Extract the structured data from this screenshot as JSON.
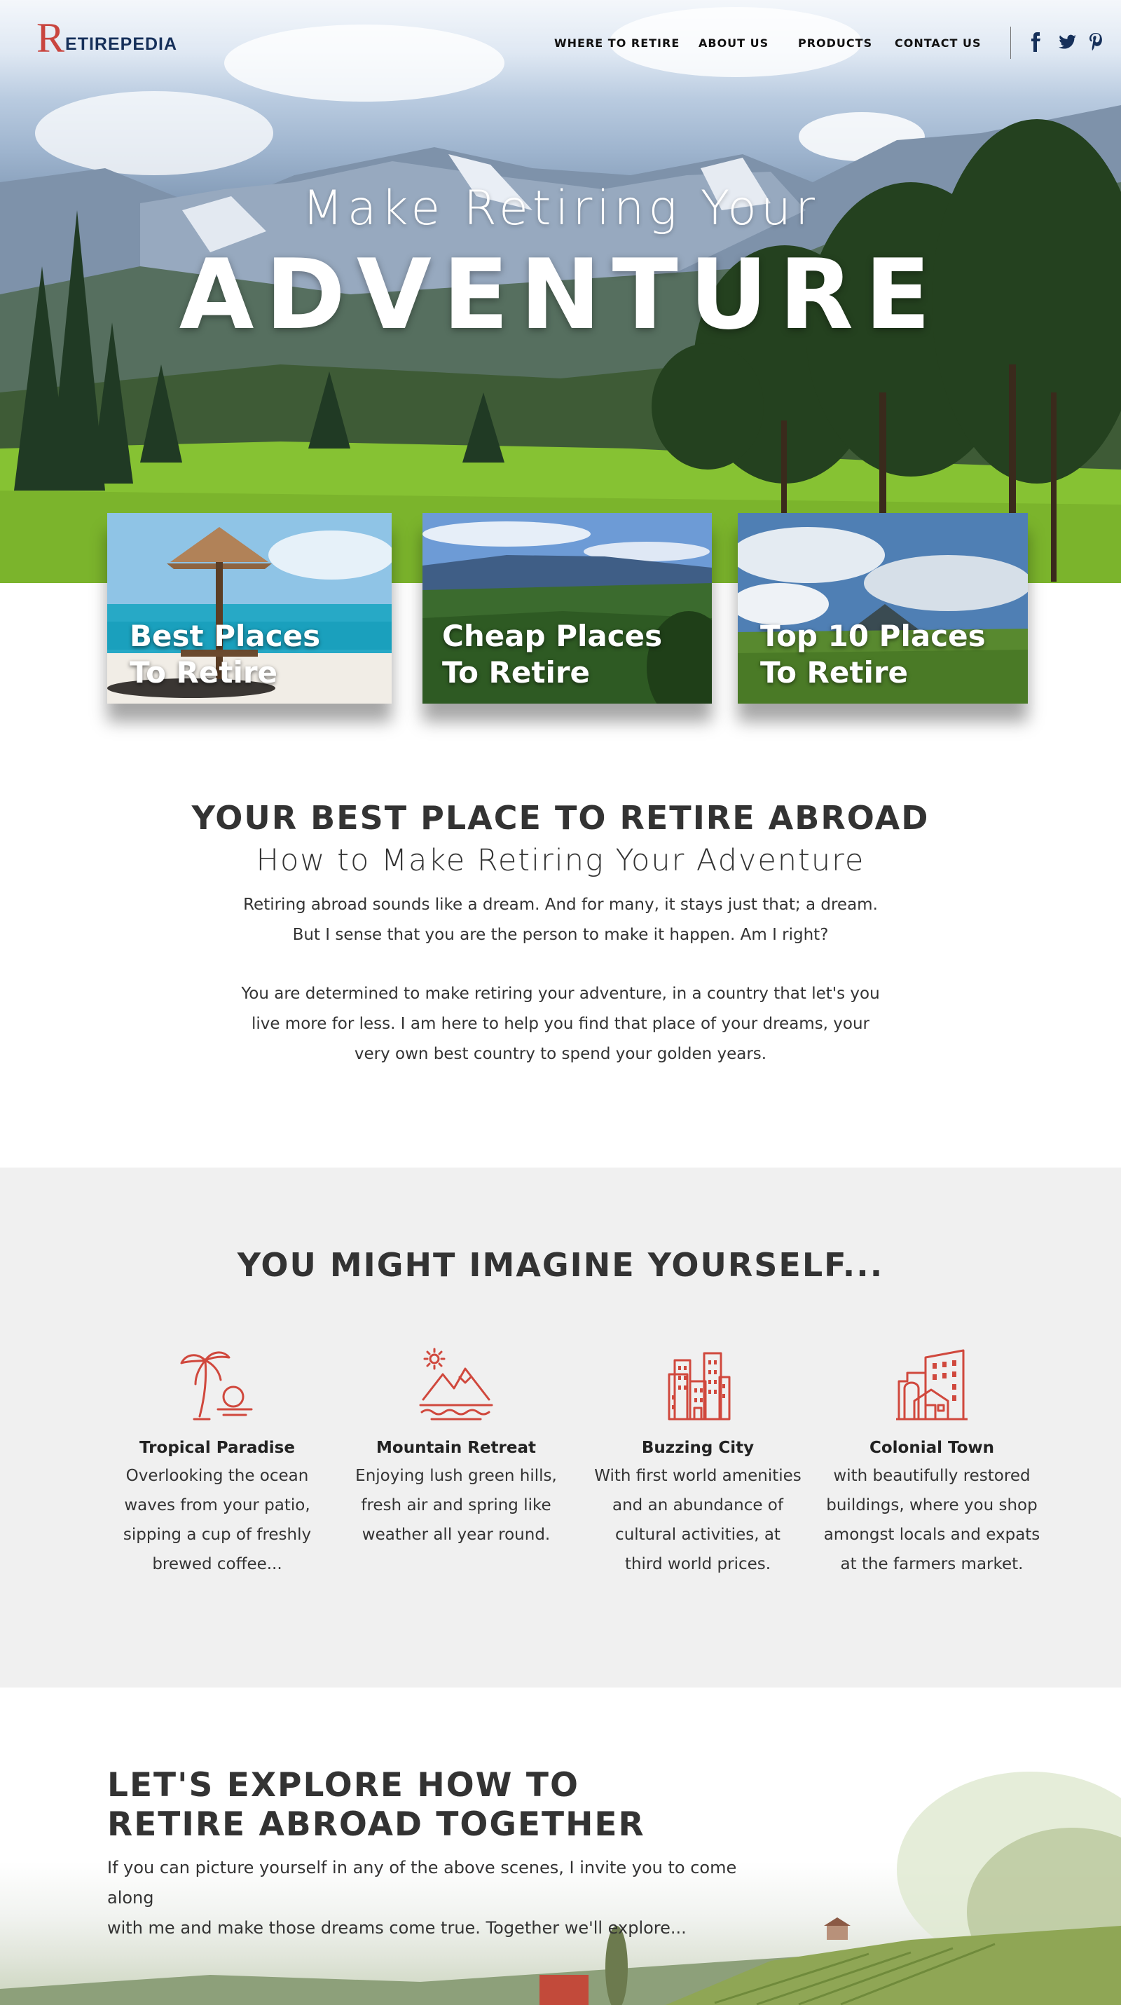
{
  "header": {
    "logo_initial": "R",
    "logo_rest": "ETIREPEDIA",
    "nav": [
      "WHERE TO RETIRE",
      "ABOUT US",
      "PRODUCTS",
      "CONTACT US"
    ],
    "social_icons": [
      "facebook-icon",
      "twitter-icon",
      "pinterest-icon"
    ]
  },
  "hero": {
    "subtitle": "Make Retiring Your",
    "title": "ADVENTURE"
  },
  "cards": [
    {
      "line1": "Best Places",
      "line2": "To Retire"
    },
    {
      "line1": "Cheap Places",
      "line2": "To Retire"
    },
    {
      "line1": "Top 10 Places",
      "line2": "To Retire"
    }
  ],
  "intro": {
    "heading": "YOUR BEST PLACE TO RETIRE ABROAD",
    "subheading": "How to Make Retiring Your Adventure",
    "p1_line1": "Retiring abroad sounds like a dream. And for many, it stays just that; a dream.",
    "p1_line2": "But I sense that you are the person to make it happen. Am I right?",
    "p2_line1": "You are determined to make retiring your adventure, in a country that let's you",
    "p2_line2": "live more for less. I am here to help you find that place of your dreams, your",
    "p2_line3": "very own best country to spend your golden years."
  },
  "imagine": {
    "heading": "YOU MIGHT IMAGINE YOURSELF...",
    "features": [
      {
        "icon": "palm-sunset-icon",
        "title": "Tropical Paradise",
        "lines": [
          "Overlooking the ocean",
          "waves from your patio,",
          "sipping a cup of freshly",
          "brewed coffee..."
        ]
      },
      {
        "icon": "mountain-sun-icon",
        "title": "Mountain Retreat",
        "lines": [
          "Enjoying lush green hills,",
          "fresh air and spring like",
          "weather all year round."
        ]
      },
      {
        "icon": "city-buildings-icon",
        "title": "Buzzing City",
        "lines": [
          "With first world amenities",
          "and an abundance of",
          "cultural activities, at",
          "third world prices."
        ]
      },
      {
        "icon": "colonial-house-icon",
        "title": "Colonial Town",
        "lines": [
          "with beautifully restored",
          "buildings, where you shop",
          "amongst locals and expats",
          "at the farmers market."
        ]
      }
    ]
  },
  "explore": {
    "heading_line1": "LET'S EXPLORE HOW TO",
    "heading_line2": "RETIRE ABROAD TOGETHER",
    "p_line1": "If you can picture yourself in any of the above scenes, I invite you to come along",
    "p_line2": "with me and make those dreams come true. Together we'll explore..."
  },
  "colors": {
    "accent_red": "#c9453f",
    "navy": "#16305a",
    "icon_red": "#d0483d",
    "section_gray": "#f0f0f0"
  }
}
